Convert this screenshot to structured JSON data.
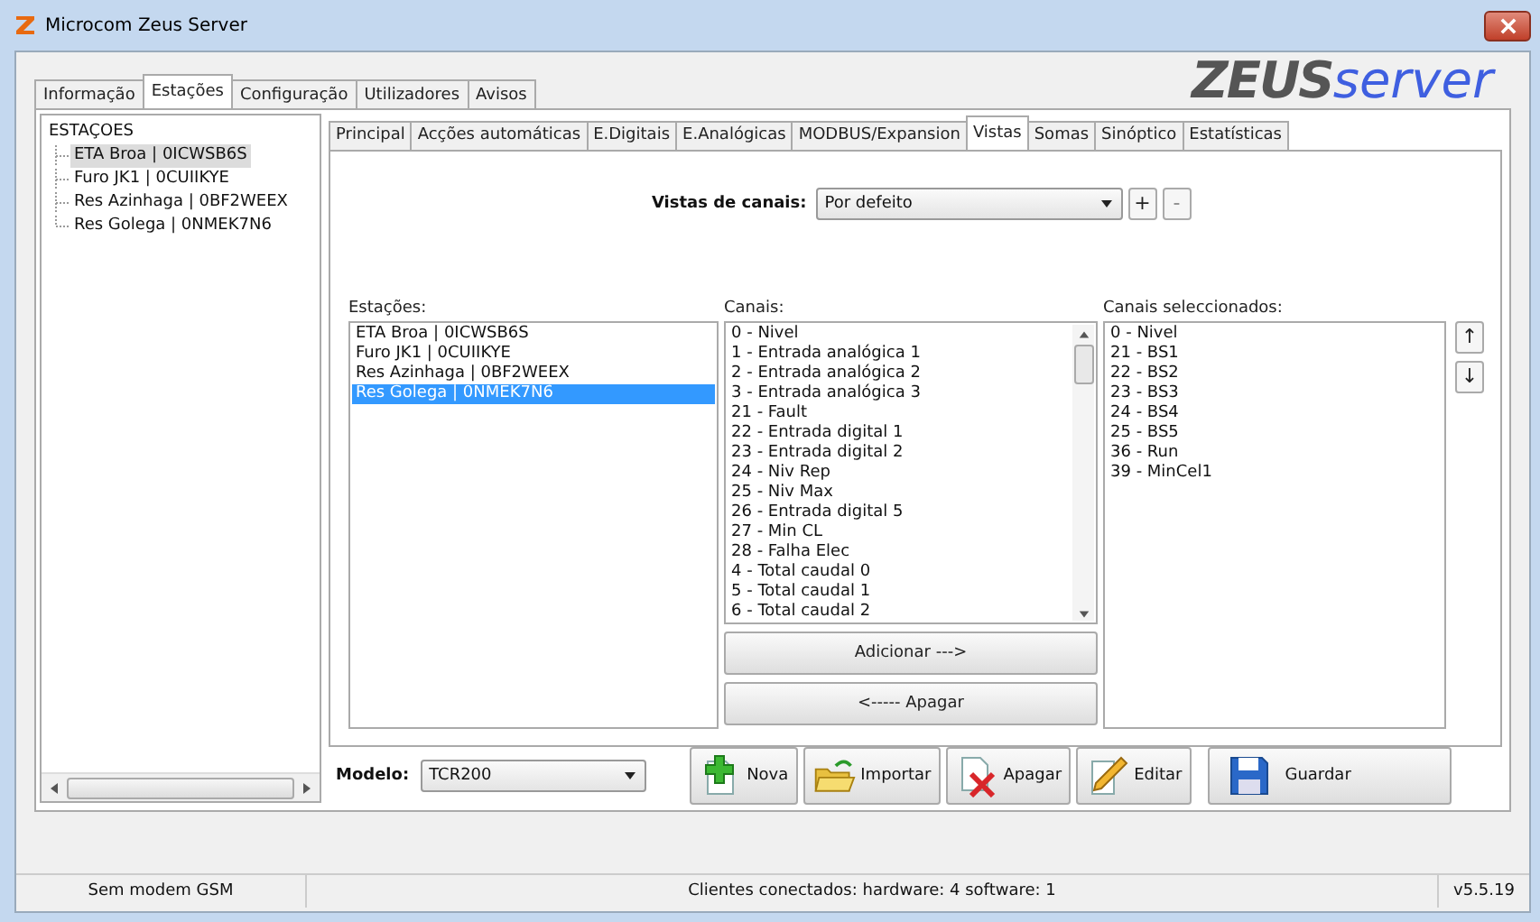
{
  "window": {
    "title": "Microcom Zeus Server"
  },
  "logo": {
    "bold": "ZEUS",
    "light": "server"
  },
  "tabs": [
    {
      "label": "Informação",
      "selected": false
    },
    {
      "label": "Estações",
      "selected": true
    },
    {
      "label": "Configuração",
      "selected": false
    },
    {
      "label": "Utilizadores",
      "selected": false
    },
    {
      "label": "Avisos",
      "selected": false
    }
  ],
  "tree": {
    "root": "ESTAÇOES",
    "children": [
      {
        "label": "ETA Broa | 0ICWSB6S",
        "selected": true
      },
      {
        "label": "Furo JK1 | 0CUIIKYE",
        "selected": false
      },
      {
        "label": "Res Azinhaga | 0BF2WEEX",
        "selected": false
      },
      {
        "label": "Res Golega | 0NMEK7N6",
        "selected": false
      }
    ]
  },
  "subtabs": [
    {
      "label": "Principal",
      "selected": false
    },
    {
      "label": "Acções automáticas",
      "selected": false
    },
    {
      "label": "E.Digitais",
      "selected": false
    },
    {
      "label": "E.Analógicas",
      "selected": false
    },
    {
      "label": "MODBUS/Expansion",
      "selected": false
    },
    {
      "label": "Vistas",
      "selected": true
    },
    {
      "label": "Somas",
      "selected": false
    },
    {
      "label": "Sinóptico",
      "selected": false
    },
    {
      "label": "Estatísticas",
      "selected": false
    }
  ],
  "views": {
    "label": "Vistas de canais:",
    "value": "Por defeito",
    "add": "+",
    "remove": "-"
  },
  "stations": {
    "label": "Estações:",
    "items": [
      {
        "label": "ETA Broa | 0ICWSB6S",
        "selected": false
      },
      {
        "label": "Furo JK1 | 0CUIIKYE",
        "selected": false
      },
      {
        "label": "Res Azinhaga | 0BF2WEEX",
        "selected": false
      },
      {
        "label": "Res Golega | 0NMEK7N6",
        "selected": true
      }
    ]
  },
  "channels": {
    "label": "Canais:",
    "items": [
      "0 - Nivel",
      "1 - Entrada analógica 1",
      "2 - Entrada analógica 2",
      "3 - Entrada analógica 3",
      "21 - Fault",
      "22 - Entrada digital 1",
      "23 - Entrada digital 2",
      "24 - Niv Rep",
      "25 - Niv Max",
      "26 - Entrada digital 5",
      "27 - Min CL",
      "28 - Falha Elec",
      "4 - Total caudal 0",
      "5 - Total caudal 1",
      "6 - Total caudal 2"
    ],
    "add_button": "Adicionar --->",
    "remove_button": "<----- Apagar"
  },
  "selected_channels": {
    "label": "Canais seleccionados:",
    "items": [
      "0 - Nivel",
      "21 - BS1",
      "22 - BS2",
      "23 - BS3",
      "24 - BS4",
      "25 - BS5",
      "36 - Run",
      "39 - MinCel1"
    ],
    "up": "↑",
    "down": "↓"
  },
  "model": {
    "label": "Modelo:",
    "value": "TCR200"
  },
  "actions": [
    {
      "kind": "new",
      "label": "Nova"
    },
    {
      "kind": "import",
      "label": "Importar"
    },
    {
      "kind": "delete",
      "label": "Apagar"
    },
    {
      "kind": "edit",
      "label": "Editar"
    },
    {
      "kind": "save",
      "label": "Guardar"
    }
  ],
  "status_bar": {
    "modem": "Sem modem GSM",
    "clients": "Clientes conectados:  hardware: 4   software: 1",
    "version": "v5.5.19"
  }
}
